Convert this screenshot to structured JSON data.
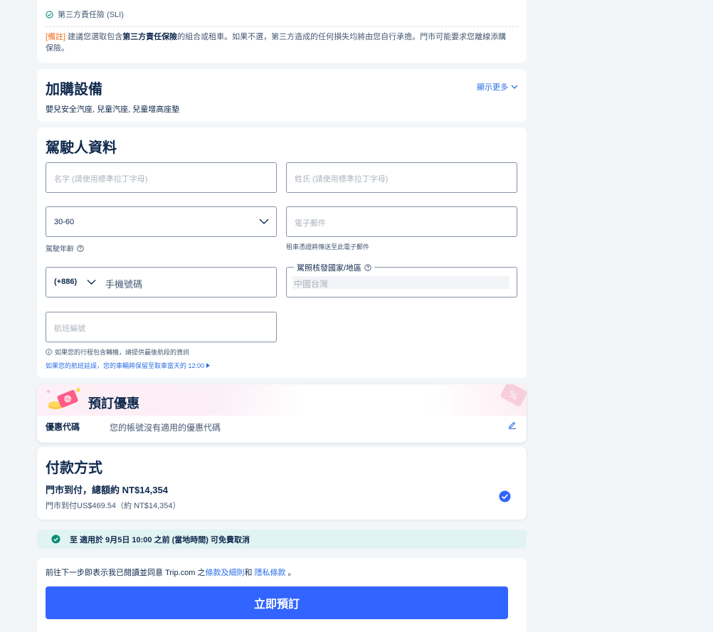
{
  "insurance": {
    "sli_label": "第三方責任險 (SLI)",
    "note_tag": "[備註]",
    "note_pre": " 建議您選取包含",
    "note_bold": "第三方責任保險",
    "note_post": "的組合或租車。如果不選，第三方造成的任何損失均將由您自行承擔。門市可能要求您離線添購保險。"
  },
  "extras": {
    "title": "加購設備",
    "show_more": "顯示更多",
    "items_text": "嬰兒安全汽座, 兒童汽座, 兒童增高座墊"
  },
  "driver": {
    "title": "駕駛人資料",
    "first_name_placeholder": "名字 (請使用標準拉丁字母)",
    "last_name_placeholder": "姓氏 (請使用標準拉丁字母)",
    "age_value": "30-60",
    "age_label": "駕駛年齡",
    "email_placeholder": "電子郵件",
    "email_helper": "租車憑證將傳送至此電子郵件",
    "phone_code": "(+886)",
    "phone_placeholder": "手機號碼",
    "license_label": "駕照核發國家/地區",
    "license_value": "中國台灣",
    "flight_placeholder": "航班編號",
    "flight_info": "如果您的行程包含轉機，請提供最後航段的資訊",
    "flight_link": "如果您的航班延誤，您的車輛將保留至取車當天的 12:00"
  },
  "promo": {
    "title": "預訂優惠",
    "label": "優惠代碼",
    "value": "您的帳號沒有適用的優惠代碼"
  },
  "payment": {
    "title": "付款方式",
    "main": "門市到付，總額約 NT$14,354",
    "sub": "門市到付US$469.54（約 NT$14,354）"
  },
  "cancel": {
    "text": "至 適用於 9月5日 10:00 之前 (當地時間) 可免費取消"
  },
  "footer": {
    "terms_pre": "前往下一步即表示我已閱讀並同意 Trip.com 之",
    "terms_link": "條款及細則",
    "terms_and": "和 ",
    "privacy_link": "隱私條款",
    "terms_end": " 。",
    "book_button": "立即預訂"
  },
  "colors": {
    "accent": "#3264ff",
    "link": "#2b6ee8",
    "text": "#0f294d",
    "note_tag": "#f16c1b",
    "cancel_bg": "#e2f3f3",
    "cancel_icon": "#0a8c74"
  },
  "icons": [
    "check-circle-icon",
    "chevron-down-icon",
    "question-icon",
    "info-icon",
    "triangle-right-icon",
    "coupon-icon",
    "edit-icon",
    "checked-circle-icon"
  ]
}
